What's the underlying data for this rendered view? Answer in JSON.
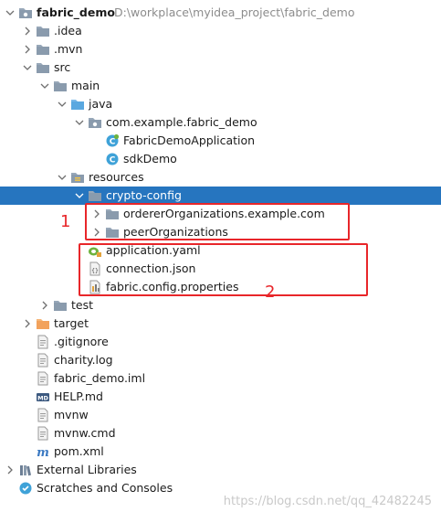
{
  "tree": [
    {
      "name": "project-root-fabric_demo",
      "label": "fabric_demo",
      "path": "D:\\workplace\\myidea_project\\fabric_demo",
      "icon": "folder-module-icon",
      "arrow": "down",
      "depth": 0,
      "bold": true
    },
    {
      "name": "folder-idea",
      "label": ".idea",
      "icon": "folder-icon",
      "arrow": "right",
      "depth": 1
    },
    {
      "name": "folder-mvn",
      "label": ".mvn",
      "icon": "folder-icon",
      "arrow": "right",
      "depth": 1
    },
    {
      "name": "folder-src",
      "label": "src",
      "icon": "folder-icon",
      "arrow": "down",
      "depth": 1
    },
    {
      "name": "folder-main",
      "label": "main",
      "icon": "folder-icon",
      "arrow": "down",
      "depth": 2
    },
    {
      "name": "folder-java",
      "label": "java",
      "icon": "source-folder-icon",
      "arrow": "down",
      "depth": 3
    },
    {
      "name": "package-com-example-fabric_demo",
      "label": "com.example.fabric_demo",
      "icon": "package-icon",
      "arrow": "down",
      "depth": 4
    },
    {
      "name": "class-FabricDemoApplication",
      "label": "FabricDemoApplication",
      "icon": "spring-class-icon",
      "arrow": "none",
      "depth": 5
    },
    {
      "name": "class-sdkDemo",
      "label": "sdkDemo",
      "icon": "class-icon",
      "arrow": "none",
      "depth": 5
    },
    {
      "name": "folder-resources",
      "label": "resources",
      "icon": "resources-folder-icon",
      "arrow": "down",
      "depth": 3
    },
    {
      "name": "folder-crypto-config",
      "label": "crypto-config",
      "icon": "folder-icon",
      "arrow": "down",
      "depth": 4,
      "selected": true
    },
    {
      "name": "folder-ordererOrganizations",
      "label": "ordererOrganizations.example.com",
      "icon": "folder-icon",
      "arrow": "right",
      "depth": 5
    },
    {
      "name": "folder-peerOrganizations",
      "label": "peerOrganizations",
      "icon": "folder-icon",
      "arrow": "right",
      "depth": 5
    },
    {
      "name": "file-application-yaml",
      "label": "application.yaml",
      "icon": "spring-yaml-icon",
      "arrow": "none",
      "depth": 4
    },
    {
      "name": "file-connection-json",
      "label": "connection.json",
      "icon": "json-file-icon",
      "arrow": "none",
      "depth": 4
    },
    {
      "name": "file-fabric-config-properties",
      "label": "fabric.config.properties",
      "icon": "properties-file-icon",
      "arrow": "none",
      "depth": 4
    },
    {
      "name": "folder-test",
      "label": "test",
      "icon": "folder-icon",
      "arrow": "right",
      "depth": 2
    },
    {
      "name": "folder-target",
      "label": "target",
      "icon": "excluded-folder-icon",
      "arrow": "right",
      "depth": 1
    },
    {
      "name": "file-gitignore",
      "label": ".gitignore",
      "icon": "text-file-icon",
      "arrow": "none",
      "depth": 1
    },
    {
      "name": "file-charity-log",
      "label": "charity.log",
      "icon": "text-file-icon",
      "arrow": "none",
      "depth": 1
    },
    {
      "name": "file-fabric_demo-iml",
      "label": "fabric_demo.iml",
      "icon": "iml-file-icon",
      "arrow": "none",
      "depth": 1
    },
    {
      "name": "file-HELP-md",
      "label": "HELP.md",
      "icon": "markdown-file-icon",
      "arrow": "none",
      "depth": 1
    },
    {
      "name": "file-mvnw",
      "label": "mvnw",
      "icon": "text-file-icon",
      "arrow": "none",
      "depth": 1
    },
    {
      "name": "file-mvnw-cmd",
      "label": "mvnw.cmd",
      "icon": "text-file-icon",
      "arrow": "none",
      "depth": 1
    },
    {
      "name": "file-pom-xml",
      "label": "pom.xml",
      "icon": "maven-icon",
      "arrow": "none",
      "depth": 1
    },
    {
      "name": "external-libraries",
      "label": "External Libraries",
      "icon": "libraries-icon",
      "arrow": "right",
      "depth": 0
    },
    {
      "name": "scratches-and-consoles",
      "label": "Scratches and Consoles",
      "icon": "scratches-icon",
      "arrow": "none",
      "depth": 0
    }
  ],
  "annotations": [
    {
      "name": "annotation-1",
      "text": "1"
    },
    {
      "name": "annotation-2",
      "text": "2"
    }
  ],
  "watermark": "https://blog.csdn.net/qq_42482245",
  "colors": {
    "selection": "#2675bf",
    "annotation": "#e8262a",
    "folder": "#8a9bad",
    "source_folder": "#5aa8e0",
    "resources_folder": "#8a9bad",
    "excluded_folder": "#f2a25c"
  }
}
